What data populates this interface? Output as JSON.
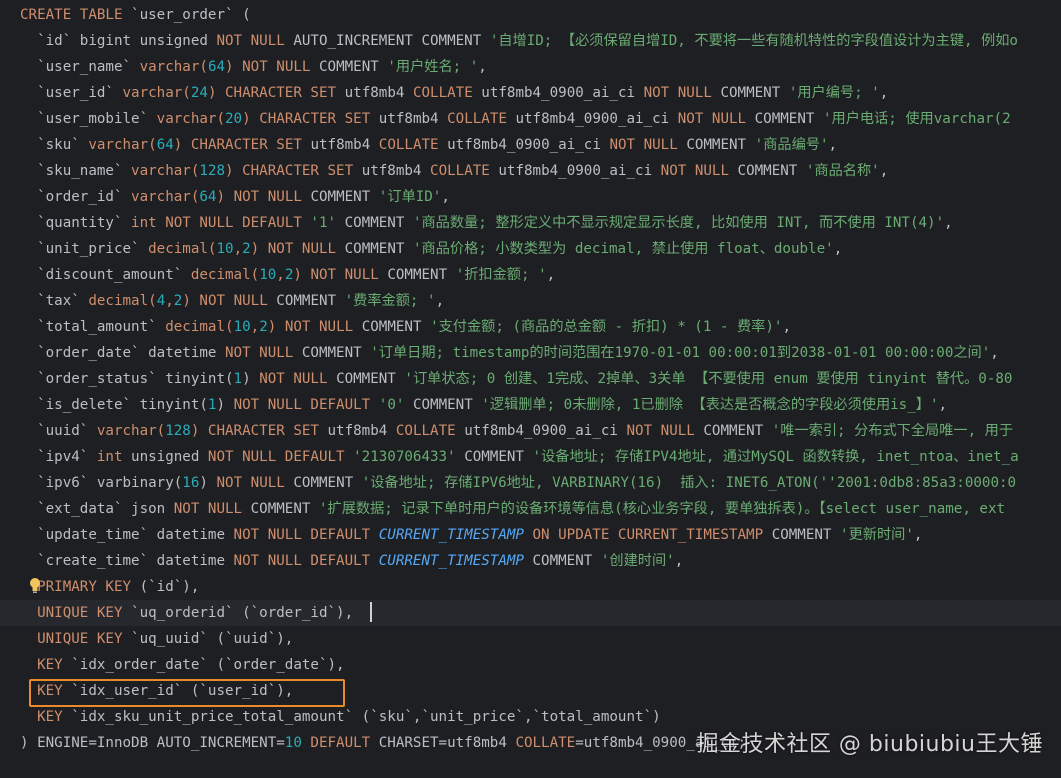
{
  "colors": {
    "background": "#1e1f22",
    "keyword": "#cf8e6d",
    "string": "#6aab73",
    "number": "#2aacb8",
    "plain": "#bcbec4",
    "function": "#56a8f5",
    "highlight_box": "#e8892b"
  },
  "icons": {
    "intention_bulb": "lightbulb-icon"
  },
  "editor": {
    "current_line": 23,
    "highlighted_line": 26,
    "lines": [
      [
        [
          "k",
          "CREATE TABLE "
        ],
        [
          "p",
          "`user_order` ("
        ]
      ],
      [
        [
          "p",
          "  `id` bigint unsigned "
        ],
        [
          "k",
          "NOT NULL "
        ],
        [
          "p",
          "AUTO_INCREMENT COMMENT "
        ],
        [
          "s",
          "'自增ID; 【必须保留自增ID, 不要将一些有随机特性的字段值设计为主键, 例如o"
        ]
      ],
      [
        [
          "p",
          "  `user_name` "
        ],
        [
          "k",
          "varchar("
        ],
        [
          "n",
          "64"
        ],
        [
          "k",
          ") NOT NULL "
        ],
        [
          "p",
          "COMMENT "
        ],
        [
          "s",
          "'用户姓名; '"
        ],
        [
          "p",
          ","
        ]
      ],
      [
        [
          "p",
          "  `user_id` "
        ],
        [
          "k",
          "varchar("
        ],
        [
          "n",
          "24"
        ],
        [
          "k",
          ") CHARACTER SET "
        ],
        [
          "p",
          "utf8mb4 "
        ],
        [
          "k",
          "COLLATE "
        ],
        [
          "p",
          "utf8mb4_0900_ai_ci "
        ],
        [
          "k",
          "NOT NULL "
        ],
        [
          "p",
          "COMMENT "
        ],
        [
          "s",
          "'用户编号; '"
        ],
        [
          "p",
          ","
        ]
      ],
      [
        [
          "p",
          "  `user_mobile` "
        ],
        [
          "k",
          "varchar("
        ],
        [
          "n",
          "20"
        ],
        [
          "k",
          ") CHARACTER SET "
        ],
        [
          "p",
          "utf8mb4 "
        ],
        [
          "k",
          "COLLATE "
        ],
        [
          "p",
          "utf8mb4_0900_ai_ci "
        ],
        [
          "k",
          "NOT NULL "
        ],
        [
          "p",
          "COMMENT "
        ],
        [
          "s",
          "'用户电话; 使用varchar(2"
        ]
      ],
      [
        [
          "p",
          "  `sku` "
        ],
        [
          "k",
          "varchar("
        ],
        [
          "n",
          "64"
        ],
        [
          "k",
          ") CHARACTER SET "
        ],
        [
          "p",
          "utf8mb4 "
        ],
        [
          "k",
          "COLLATE "
        ],
        [
          "p",
          "utf8mb4_0900_ai_ci "
        ],
        [
          "k",
          "NOT NULL "
        ],
        [
          "p",
          "COMMENT "
        ],
        [
          "s",
          "'商品编号'"
        ],
        [
          "p",
          ","
        ]
      ],
      [
        [
          "p",
          "  `sku_name` "
        ],
        [
          "k",
          "varchar("
        ],
        [
          "n",
          "128"
        ],
        [
          "k",
          ") CHARACTER SET "
        ],
        [
          "p",
          "utf8mb4 "
        ],
        [
          "k",
          "COLLATE "
        ],
        [
          "p",
          "utf8mb4_0900_ai_ci "
        ],
        [
          "k",
          "NOT NULL "
        ],
        [
          "p",
          "COMMENT "
        ],
        [
          "s",
          "'商品名称'"
        ],
        [
          "p",
          ","
        ]
      ],
      [
        [
          "p",
          "  `order_id` "
        ],
        [
          "k",
          "varchar("
        ],
        [
          "n",
          "64"
        ],
        [
          "k",
          ") NOT NULL "
        ],
        [
          "p",
          "COMMENT "
        ],
        [
          "s",
          "'订单ID'"
        ],
        [
          "p",
          ","
        ]
      ],
      [
        [
          "p",
          "  `quantity` "
        ],
        [
          "k",
          "int NOT NULL DEFAULT "
        ],
        [
          "s",
          "'1' "
        ],
        [
          "p",
          "COMMENT "
        ],
        [
          "s",
          "'商品数量; 整形定义中不显示规定显示长度, 比如使用 INT, 而不使用 INT(4)'"
        ],
        [
          "p",
          ","
        ]
      ],
      [
        [
          "p",
          "  `unit_price` "
        ],
        [
          "k",
          "decimal("
        ],
        [
          "n",
          "10"
        ],
        [
          "k",
          ","
        ],
        [
          "n",
          "2"
        ],
        [
          "k",
          ") NOT NULL "
        ],
        [
          "p",
          "COMMENT "
        ],
        [
          "s",
          "'商品价格; 小数类型为 decimal, 禁止使用 float、double'"
        ],
        [
          "p",
          ","
        ]
      ],
      [
        [
          "p",
          "  `discount_amount` "
        ],
        [
          "k",
          "decimal("
        ],
        [
          "n",
          "10"
        ],
        [
          "k",
          ","
        ],
        [
          "n",
          "2"
        ],
        [
          "k",
          ") NOT NULL "
        ],
        [
          "p",
          "COMMENT "
        ],
        [
          "s",
          "'折扣金额; '"
        ],
        [
          "p",
          ","
        ]
      ],
      [
        [
          "p",
          "  `tax` "
        ],
        [
          "k",
          "decimal("
        ],
        [
          "n",
          "4"
        ],
        [
          "k",
          ","
        ],
        [
          "n",
          "2"
        ],
        [
          "k",
          ") NOT NULL "
        ],
        [
          "p",
          "COMMENT "
        ],
        [
          "s",
          "'费率金额; '"
        ],
        [
          "p",
          ","
        ]
      ],
      [
        [
          "p",
          "  `total_amount` "
        ],
        [
          "k",
          "decimal("
        ],
        [
          "n",
          "10"
        ],
        [
          "k",
          ","
        ],
        [
          "n",
          "2"
        ],
        [
          "k",
          ") NOT NULL "
        ],
        [
          "p",
          "COMMENT "
        ],
        [
          "s",
          "'支付金额; (商品的总金额 - 折扣) * (1 - 费率)'"
        ],
        [
          "p",
          ","
        ]
      ],
      [
        [
          "p",
          "  `order_date` datetime "
        ],
        [
          "k",
          "NOT NULL "
        ],
        [
          "p",
          "COMMENT "
        ],
        [
          "s",
          "'订单日期; timestamp的时间范围在1970-01-01 00:00:01到2038-01-01 00:00:00之间'"
        ],
        [
          "p",
          ","
        ]
      ],
      [
        [
          "p",
          "  `order_status` tinyint("
        ],
        [
          "n",
          "1"
        ],
        [
          "p",
          ") "
        ],
        [
          "k",
          "NOT NULL "
        ],
        [
          "p",
          "COMMENT "
        ],
        [
          "s",
          "'订单状态; 0 创建、1完成、2掉单、3关单 【不要使用 enum 要使用 tinyint 替代。0-80"
        ]
      ],
      [
        [
          "p",
          "  `is_delete` tinyint("
        ],
        [
          "n",
          "1"
        ],
        [
          "p",
          ") "
        ],
        [
          "k",
          "NOT NULL DEFAULT "
        ],
        [
          "s",
          "'0' "
        ],
        [
          "p",
          "COMMENT "
        ],
        [
          "s",
          "'逻辑删单; 0未删除, 1已删除 【表达是否概念的字段必须使用is_】'"
        ],
        [
          "p",
          ","
        ]
      ],
      [
        [
          "p",
          "  `uuid` "
        ],
        [
          "k",
          "varchar("
        ],
        [
          "n",
          "128"
        ],
        [
          "k",
          ") CHARACTER SET "
        ],
        [
          "p",
          "utf8mb4 "
        ],
        [
          "k",
          "COLLATE "
        ],
        [
          "p",
          "utf8mb4_0900_ai_ci "
        ],
        [
          "k",
          "NOT NULL "
        ],
        [
          "p",
          "COMMENT "
        ],
        [
          "s",
          "'唯一索引; 分布式下全局唯一, 用于"
        ]
      ],
      [
        [
          "p",
          "  `ipv4` "
        ],
        [
          "k",
          "int "
        ],
        [
          "p",
          "unsigned "
        ],
        [
          "k",
          "NOT NULL DEFAULT "
        ],
        [
          "s",
          "'2130706433' "
        ],
        [
          "p",
          "COMMENT "
        ],
        [
          "s",
          "'设备地址; 存储IPV4地址, 通过MySQL 函数转换, inet_ntoa、inet_a"
        ]
      ],
      [
        [
          "p",
          "  `ipv6` varbinary("
        ],
        [
          "n",
          "16"
        ],
        [
          "p",
          ") "
        ],
        [
          "k",
          "NOT NULL "
        ],
        [
          "p",
          "COMMENT "
        ],
        [
          "s",
          "'设备地址; 存储IPV6地址, VARBINARY(16)  插入: INET6_ATON(''2001:0db8:85a3:0000:0"
        ]
      ],
      [
        [
          "p",
          "  `ext_data` json "
        ],
        [
          "k",
          "NOT NULL "
        ],
        [
          "p",
          "COMMENT "
        ],
        [
          "s",
          "'扩展数据; 记录下单时用户的设备环境等信息(核心业务字段, 要单独拆表)。【select user_name, ext"
        ]
      ],
      [
        [
          "p",
          "  `update_time` datetime "
        ],
        [
          "k",
          "NOT NULL DEFAULT "
        ],
        [
          "f",
          "CURRENT_TIMESTAMP "
        ],
        [
          "k",
          "ON UPDATE CURRENT_TIMESTAMP "
        ],
        [
          "p",
          "COMMENT "
        ],
        [
          "s",
          "'更新时间'"
        ],
        [
          "p",
          ","
        ]
      ],
      [
        [
          "p",
          "  `create_time` datetime "
        ],
        [
          "k",
          "NOT NULL DEFAULT "
        ],
        [
          "f",
          "CURRENT_TIMESTAMP "
        ],
        [
          "p",
          "COMMENT "
        ],
        [
          "s",
          "'创建时间'"
        ],
        [
          "p",
          ","
        ]
      ],
      [
        [
          "k",
          "  PRIMARY KEY "
        ],
        [
          "p",
          "(`id`),"
        ]
      ],
      [
        [
          "k",
          "  UNIQUE KEY "
        ],
        [
          "p",
          "`uq_orderid` (`order_id`),"
        ]
      ],
      [
        [
          "k",
          "  UNIQUE KEY "
        ],
        [
          "p",
          "`uq_uuid` (`uuid`),"
        ]
      ],
      [
        [
          "k",
          "  KEY "
        ],
        [
          "p",
          "`idx_order_date` (`order_date`),"
        ]
      ],
      [
        [
          "k",
          "  KEY "
        ],
        [
          "p",
          "`idx_user_id` (`user_id`),"
        ]
      ],
      [
        [
          "k",
          "  KEY "
        ],
        [
          "p",
          "`idx_sku_unit_price_total_amount` (`sku`,`unit_price`,`total_amount`)"
        ]
      ],
      [
        [
          "p",
          ") ENGINE=InnoDB AUTO_INCREMENT="
        ],
        [
          "n",
          "10 "
        ],
        [
          "k",
          "DEFAULT "
        ],
        [
          "p",
          "CHARSET=utf8mb4 "
        ],
        [
          "k",
          "COLLATE"
        ],
        [
          "p",
          "=utf8mb4_0900_ai_ci;"
        ]
      ]
    ]
  },
  "watermark": "掘金技术社区 @ biubiubiu王大锤"
}
